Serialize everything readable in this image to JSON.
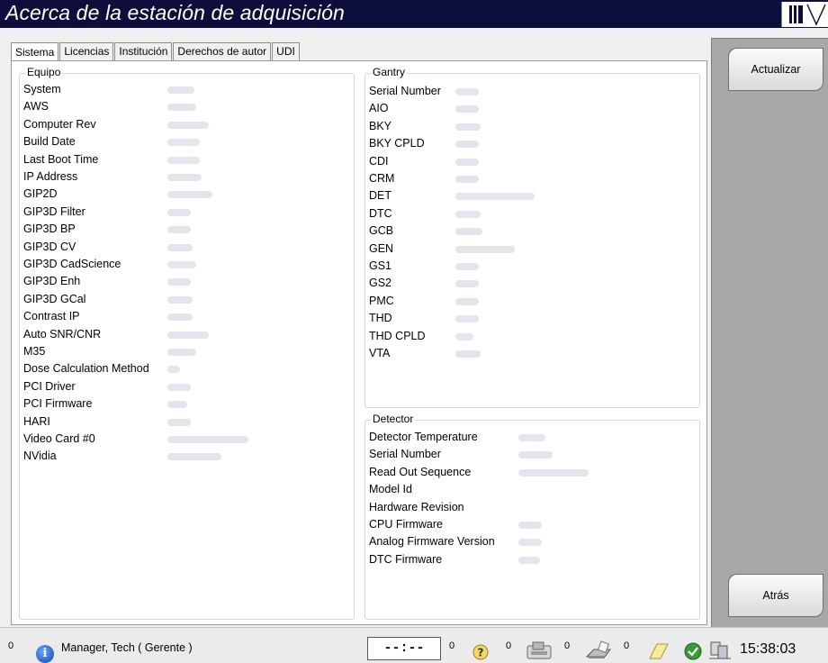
{
  "window": {
    "title": "Acerca de la estación de adquisición"
  },
  "tabs": [
    {
      "label": "Sistema",
      "active": true
    },
    {
      "label": "Licencias",
      "active": false
    },
    {
      "label": "Institución",
      "active": false
    },
    {
      "label": "Derechos de autor",
      "active": false
    },
    {
      "label": "UDI",
      "active": false
    }
  ],
  "equipo": {
    "label": "Equipo",
    "items": [
      "System",
      "AWS",
      "Computer Rev",
      "Build Date",
      "Last Boot Time",
      "IP Address",
      "GIP2D",
      "GIP3D Filter",
      "GIP3D BP",
      "GIP3D CV",
      "GIP3D CadScience",
      "GIP3D Enh",
      "GIP3D GCal",
      "Contrast IP",
      "Auto SNR/CNR",
      "M35",
      "Dose Calculation Method",
      "PCI Driver",
      "PCI Firmware",
      "HARI",
      "Video Card #0",
      "NVidia"
    ]
  },
  "gantry": {
    "label": "Gantry",
    "items": [
      "Serial Number",
      "AIO",
      "BKY",
      "BKY CPLD",
      "CDI",
      "CRM",
      "DET",
      "DTC",
      "GCB",
      "GEN",
      "GS1",
      "GS2",
      "PMC",
      "THD",
      "THD CPLD",
      "VTA"
    ]
  },
  "detector": {
    "label": "Detector",
    "items": [
      "Detector Temperature",
      "Serial Number",
      "Read Out Sequence",
      "Model Id",
      "Hardware Revision",
      "CPU Firmware",
      "Analog Firmware Version",
      "DTC Firmware"
    ]
  },
  "sidebar": {
    "refresh_label": "Actualizar",
    "back_label": "Atrás"
  },
  "taskbar": {
    "left_count": "0",
    "user": "Manager, Tech ( Gerente )",
    "timer": "--:--",
    "counts": [
      "0",
      "0",
      "0",
      "0"
    ],
    "clock": "15:38:03"
  },
  "icons": [
    "info-icon",
    "help-icon",
    "tube-icon",
    "printer-icon",
    "note-icon",
    "check-icon",
    "network-icon"
  ],
  "colors": {
    "titlebar": "#0e0e3c",
    "sidebar": "#a8a8a8",
    "blurred_value": "#e3e5ec"
  }
}
